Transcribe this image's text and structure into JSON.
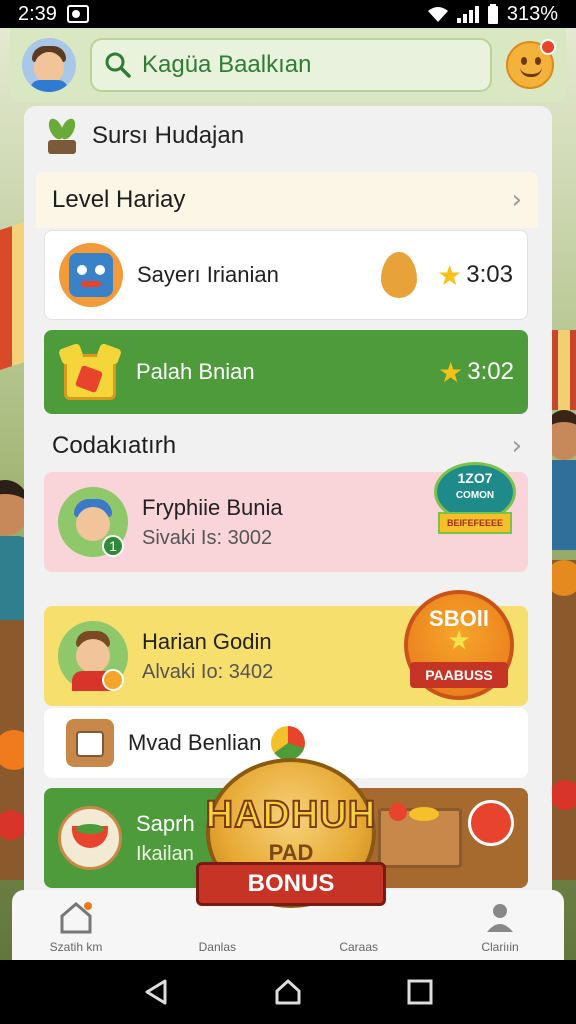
{
  "status_bar": {
    "time": "2:39",
    "battery": "313%"
  },
  "header": {
    "search_text": "Kagüa Baalkıan"
  },
  "panel": {
    "title": "Sursı Hudajan",
    "section1": {
      "title": "Level Hariay"
    },
    "rows1": [
      {
        "label": "Sayerı Irianian",
        "score": "3:03"
      },
      {
        "label": "Palah Bnian",
        "score": "3:02"
      }
    ],
    "section2": {
      "title": "Codakıatırh"
    },
    "rows2": [
      {
        "label": "Fryphiie Bunia",
        "sub": "Sivaki Is: 3002",
        "badge_top": "1ZO7",
        "badge_mid": "COMON",
        "badge_bottom": "BEIFEFEEEE"
      },
      {
        "label": "Harian Godin",
        "sub": "Alvaki Io: 3402",
        "badge_top": "SBOll",
        "badge_bottom": "PAABUSS"
      },
      {
        "label": "Mvad Benlian"
      },
      {
        "label": "Saprh",
        "sub": "Ikailan"
      }
    ]
  },
  "promo": {
    "title": "HADHUH",
    "sub": "PAD",
    "ribbon": "BONUS"
  },
  "bottom_nav": {
    "items": [
      {
        "label": "Szatih km"
      },
      {
        "label": "Danlas"
      },
      {
        "label": "Caraas"
      },
      {
        "label": "Clariıin"
      }
    ]
  },
  "colors": {
    "green": "#4e9b3c",
    "pink": "#f9d5da",
    "yellow": "#f7df6e",
    "accent": "#2f7d33"
  }
}
